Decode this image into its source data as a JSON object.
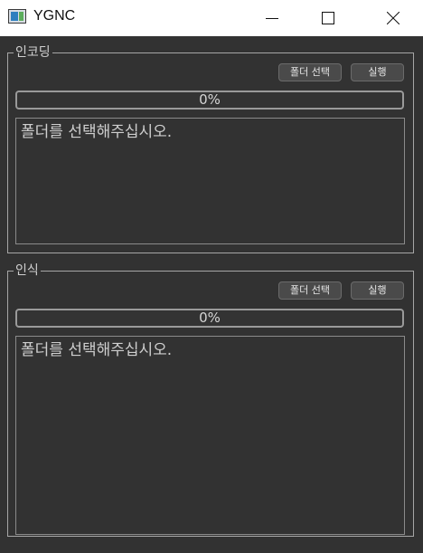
{
  "window": {
    "title": "YGNC"
  },
  "encoding": {
    "title": "인코딩",
    "folder_button": "폴더 선택",
    "run_button": "실행",
    "progress_value": 0,
    "progress_text": "0%",
    "log_text": "폴더를 선택해주십시오."
  },
  "recognition": {
    "title": "인식",
    "folder_button": "폴더 선택",
    "run_button": "실행",
    "progress_value": 0,
    "progress_text": "0%",
    "log_text": "폴더를 선택해주십시오."
  },
  "icons": {
    "app": "app-window-icon",
    "minimize": "minimize-icon",
    "maximize": "maximize-icon",
    "close": "close-icon"
  }
}
